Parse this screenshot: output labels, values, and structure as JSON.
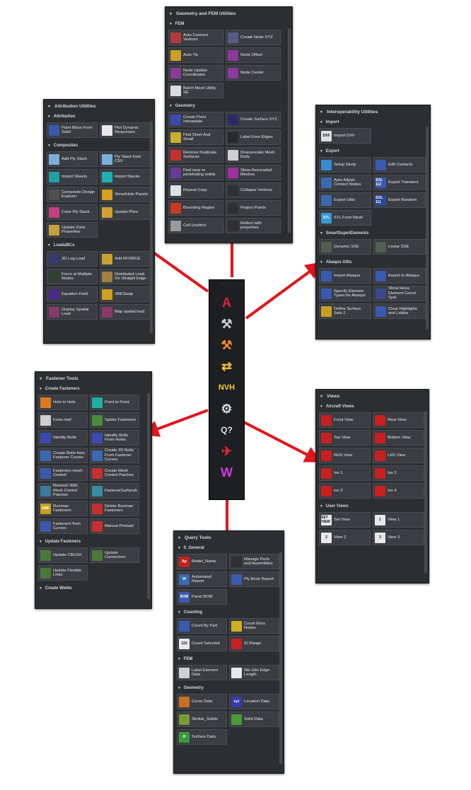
{
  "colors": {
    "arrow": "#e3141b",
    "panel_bg": "#2c2e31",
    "button_bg": "#3a3d42",
    "text": "#e8e8e8"
  },
  "toolbar": {
    "grip": "::::::::",
    "items": [
      {
        "icon": "attribution-icon",
        "glyph": "A",
        "color": "#e52233"
      },
      {
        "icon": "geometry-tools-icon",
        "glyph": "⚒",
        "color": "#cfcfcf"
      },
      {
        "icon": "fastener-tools-icon",
        "glyph": "⚒",
        "color": "#f08a24"
      },
      {
        "icon": "interoperability-icon",
        "glyph": "⇄",
        "color": "#f2c230"
      },
      {
        "icon": "nvh-icon",
        "glyph": "NVH",
        "color": "#f2d130"
      },
      {
        "icon": "query-tools-icon",
        "glyph": "⚙",
        "color": "#d8d8d8"
      },
      {
        "icon": "query-icon",
        "glyph": "Q?",
        "color": "#e0e0e0"
      },
      {
        "icon": "aircraft-views-icon",
        "glyph": "✈",
        "color": "#e8262b"
      },
      {
        "icon": "user-views-icon",
        "glyph": "W",
        "color": "#d13bd8"
      }
    ]
  },
  "geometry_panel": {
    "title": "Geometry and FEM Utilities",
    "sections": [
      {
        "label": "FEM",
        "buttons": [
          {
            "label": "Auto Connect Vertices",
            "icon": "auto-connect-icon",
            "color": "#b33a3a"
          },
          {
            "label": "Create Node XYZ",
            "icon": "create-node-icon",
            "color": "#5a5a8a"
          },
          {
            "label": "Auto Tie",
            "icon": "auto-tie-icon",
            "color": "#c8a028"
          },
          {
            "label": "Node Offset",
            "icon": "node-offset-icon",
            "color": "#8a3a9a"
          },
          {
            "label": "Node Update Coordinates",
            "icon": "node-update-icon",
            "color": "#8a3a9a"
          },
          {
            "label": "Node Center",
            "icon": "node-center-icon",
            "color": "#8a3a9a"
          },
          {
            "label": "Batch Mesh Utility SE",
            "icon": "batch-mesh-icon",
            "color": "#dcdcdc"
          }
        ]
      },
      {
        "label": "Geometry",
        "buttons": [
          {
            "label": "Create Point Interpolate",
            "icon": "create-point-icon",
            "color": "#3a4ab0"
          },
          {
            "label": "Create Surface XYZ",
            "icon": "create-surface-icon",
            "color": "#2a2a6a"
          },
          {
            "label": "Find Short And Small",
            "icon": "find-short-icon",
            "color": "#c8b030"
          },
          {
            "label": "Label Free Edges",
            "icon": "label-free-edges-icon",
            "color": "#2a2a2a"
          },
          {
            "label": "Remove Duplicate Surfaces",
            "icon": "remove-duplicate-icon",
            "color": "#c83030"
          },
          {
            "label": "Disassociate Mesh Body",
            "icon": "disassociate-icon",
            "color": "#d0d0d0"
          },
          {
            "label": "Find near or penetrating solids",
            "icon": "find-near-icon",
            "color": "#6a3a9a"
          },
          {
            "label": "Show Associated Meshes",
            "icon": "show-associated-icon",
            "color": "#a030a0"
          },
          {
            "label": "Repeat Copy",
            "icon": "repeat-copy-icon",
            "color": "#e0e0e0"
          },
          {
            "label": "Collapse Vertices",
            "icon": "collapse-vertices-icon",
            "color": "#303030"
          },
          {
            "label": "Bounding Region",
            "icon": "bounding-region-icon",
            "color": "#c83a20"
          },
          {
            "label": "Project Points",
            "icon": "project-points-icon",
            "color": "#303030"
          },
          {
            "label": "Cell Unstitch",
            "icon": "cell-unstitch-icon",
            "color": "#9a9a9a"
          },
          {
            "label": "Reflect with properties",
            "icon": "reflect-icon",
            "color": "#303030"
          }
        ]
      }
    ]
  },
  "attribution_panel": {
    "title": "Attribution Utilities",
    "sections": [
      {
        "label": "Attribution",
        "buttons": [
          {
            "label": "Point Mass From Solid",
            "icon": "point-mass-icon",
            "color": "#3a5ab0"
          },
          {
            "label": "Plot Dynamic Responses",
            "icon": "plot-dynamic-icon",
            "color": "#e8e8e8"
          }
        ]
      },
      {
        "label": "Composites",
        "buttons": [
          {
            "label": "Add Ply Stack",
            "icon": "add-ply-stack-icon",
            "color": "#7ab0d8"
          },
          {
            "label": "Ply Stack from CSV",
            "icon": "ply-stack-csv-icon",
            "color": "#7ab0d8"
          },
          {
            "label": "Import Sheets",
            "icon": "import-sheets-icon",
            "color": "#20a0a0"
          },
          {
            "label": "Import Stacks",
            "icon": "import-stacks-icon",
            "color": "#20b0b0"
          },
          {
            "label": "Composite Design Explorer",
            "icon": "composite-explorer-icon",
            "color": "#505050"
          },
          {
            "label": "Show/Hide Panels",
            "icon": "show-hide-panels-icon",
            "color": "#d8a020"
          },
          {
            "label": "Color Ply Stack",
            "icon": "color-ply-icon",
            "color": "#c04080"
          },
          {
            "label": "Update Plies",
            "icon": "update-plies-icon",
            "color": "#d0a030"
          },
          {
            "label": "Update Zone Properties",
            "icon": "update-zone-icon",
            "color": "#c8a040"
          }
        ]
      },
      {
        "label": "LoadsBCs",
        "buttons": [
          {
            "label": "3D Lug Load",
            "icon": "lug-load-icon",
            "color": "#3a3a6a"
          },
          {
            "label": "Add RFORCE",
            "icon": "add-rforce-icon",
            "color": "#c8a030"
          },
          {
            "label": "Force at Multiple Nodes",
            "icon": "force-nodes-icon",
            "color": "#304030"
          },
          {
            "label": "Distributed Load On Straight Edge",
            "icon": "distributed-load-icon",
            "color": "#a08040"
          },
          {
            "label": "Equation Field",
            "icon": "equation-field-icon",
            "color": "#4a2a8a"
          },
          {
            "label": "XBESwap",
            "icon": "xbeswap-icon",
            "color": "#d0a020"
          },
          {
            "label": "Display Spatial Load",
            "icon": "display-spatial-icon",
            "color": "#8a3a6a"
          },
          {
            "label": "Map spatial load",
            "icon": "map-spatial-icon",
            "color": "#8a3a6a"
          }
        ]
      }
    ]
  },
  "interop_panel": {
    "title": "Interoperability Utilities",
    "sections": [
      {
        "label": "Import",
        "buttons": [
          {
            "label": "Import DXF",
            "icon": "dxf-icon",
            "color": "#e0e0e0",
            "text": "DXF"
          }
        ]
      },
      {
        "label": "Export",
        "buttons": [
          {
            "label": "Setup Study",
            "icon": "setup-study-icon",
            "color": "#3a8ad0"
          },
          {
            "label": "Edit Contacts",
            "icon": "edit-contacts-icon",
            "color": "#3a5ab0"
          },
          {
            "label": "Auto Adjust Contact Nodes",
            "icon": "auto-adjust-icon",
            "color": "#3a6ab0"
          },
          {
            "label": "Export Transient",
            "icon": "export-transient-icon",
            "color": "#3a5ab0",
            "text": "SOL 112"
          },
          {
            "label": "Export Utils",
            "icon": "export-utils-icon",
            "color": "#3a6ab0"
          },
          {
            "label": "Export Random",
            "icon": "export-random-icon",
            "color": "#2a4a9a",
            "text": "SOL 111"
          },
          {
            "label": "STL From Mesh",
            "icon": "stl-icon",
            "color": "#3a9ad0",
            "text": "STL"
          }
        ]
      },
      {
        "label": "SmartSuperElements",
        "buttons": [
          {
            "label": "Dynamic SSE",
            "icon": "dynamic-sse-icon",
            "color": "#506050"
          },
          {
            "label": "Linear SSE",
            "icon": "linear-sse-icon",
            "color": "#506050"
          }
        ]
      },
      {
        "label": "Abaqus Utils",
        "buttons": [
          {
            "label": "Import Abaqus",
            "icon": "import-abaqus-icon",
            "color": "#3a5ab0"
          },
          {
            "label": "Export to Abaqus",
            "icon": "export-abaqus-icon",
            "color": "#3a5ab0"
          },
          {
            "label": "Specify Element Types for Abaqus",
            "icon": "specify-element-icon",
            "color": "#3a5ab0"
          },
          {
            "label": "Show Hexa Element Coord Syst",
            "icon": "show-hexa-icon",
            "color": "#3a4a8a"
          },
          {
            "label": "Define Surface Sets 2",
            "icon": "define-surface-icon",
            "color": "#c8a020"
          },
          {
            "label": "Clear Highlights and Lables",
            "icon": "clear-highlights-icon",
            "color": "#3a5ab0"
          }
        ]
      }
    ]
  },
  "fastener_panel": {
    "title": "Fastener Tools",
    "sections": [
      {
        "label": "Create Fasteners",
        "buttons": [
          {
            "label": "Hole to Hole",
            "icon": "hole-to-hole-icon",
            "color": "#e07a20"
          },
          {
            "label": "Point to Point",
            "icon": "point-to-point-icon",
            "color": "#20b0a0"
          },
          {
            "label": "From mwf",
            "icon": "from-mwf-icon",
            "color": "#d0d0d0"
          },
          {
            "label": "Spider Fasteners",
            "icon": "spider-fasteners-icon",
            "color": "#4a8a3a"
          },
          {
            "label": "Identify Bolts",
            "icon": "identify-bolts-icon",
            "color": "#3a4ab0"
          },
          {
            "label": "Identify Bolts From Holes",
            "icon": "identify-holes-icon",
            "color": "#3a4ab0"
          },
          {
            "label": "Create Bolts from Fastener Curves",
            "icon": "create-bolts-icon",
            "color": "#3a6ab0"
          },
          {
            "label": "Create 2D Bolts From Fastener Curves",
            "icon": "create-2d-bolts-icon",
            "color": "#3a6ab0"
          },
          {
            "label": "Fasteners mesh Control",
            "icon": "mesh-control-icon",
            "color": "#3a5ab0"
          },
          {
            "label": "Create Mesh Control Patches",
            "icon": "mesh-patches-icon",
            "color": "#c83030"
          },
          {
            "label": "Remesh With Mesh Control Patches",
            "icon": "remesh-icon",
            "color": "#3a7a9a"
          },
          {
            "label": "FastenerSurfaceMesh",
            "icon": "fastener-surface-icon",
            "color": "#3a8aa0"
          },
          {
            "label": "Runman Fasteners",
            "icon": "runman-icon",
            "color": "#c8a020",
            "text": "RMF"
          },
          {
            "label": "Delete Runman Fasteners",
            "icon": "delete-runman-icon",
            "color": "#c83030"
          },
          {
            "label": "Fasteners from Curves",
            "icon": "fasteners-curves-icon",
            "color": "#3a5ab0"
          },
          {
            "label": "Manual Preload",
            "icon": "manual-preload-icon",
            "color": "#c83030"
          }
        ]
      },
      {
        "label": "Update Fasteners",
        "buttons": [
          {
            "label": "Update CBUSH",
            "icon": "update-cbush-icon",
            "color": "#4a7a3a"
          },
          {
            "label": "Update Connectors",
            "icon": "update-connectors-icon",
            "color": "#4a7a3a"
          },
          {
            "label": "Update Flexible Links",
            "icon": "update-flexible-icon",
            "color": "#4a7a3a"
          }
        ]
      },
      {
        "label": "Create Welds",
        "buttons": []
      }
    ]
  },
  "views_panel": {
    "title": "Views",
    "sections": [
      {
        "label": "Aircraft Views",
        "buttons": [
          {
            "label": "Front View",
            "icon": "front-view-icon",
            "color": "#c82020"
          },
          {
            "label": "Rear View",
            "icon": "rear-view-icon",
            "color": "#c82020"
          },
          {
            "label": "Top View",
            "icon": "top-view-icon",
            "color": "#c82020"
          },
          {
            "label": "Bottom View",
            "icon": "bottom-view-icon",
            "color": "#c82020"
          },
          {
            "label": "RHS View",
            "icon": "rhs-view-icon",
            "color": "#c82020"
          },
          {
            "label": "LHS View",
            "icon": "lhs-view-icon",
            "color": "#c82020"
          },
          {
            "label": "Iso 1",
            "icon": "iso1-icon",
            "color": "#c82020"
          },
          {
            "label": "Iso 2",
            "icon": "iso2-icon",
            "color": "#c82020"
          },
          {
            "label": "Iso 3",
            "icon": "iso3-icon",
            "color": "#c82020"
          },
          {
            "label": "Iso 4",
            "icon": "iso4-icon",
            "color": "#c82020"
          }
        ]
      },
      {
        "label": "User Views",
        "buttons": [
          {
            "label": "Set View",
            "icon": "set-view-icon",
            "color": "#e8e8e8",
            "text": "SET VIEW"
          },
          {
            "label": "View 1",
            "icon": "view1-icon",
            "color": "#e8e8e8",
            "text": "1"
          },
          {
            "label": "View 2",
            "icon": "view2-icon",
            "color": "#e8e8e8",
            "text": "2"
          },
          {
            "label": "View 3",
            "icon": "view3-icon",
            "color": "#e8e8e8",
            "text": "3"
          }
        ]
      }
    ]
  },
  "query_panel": {
    "title": "Query Tools",
    "sections": [
      {
        "label": "0_General",
        "buttons": [
          {
            "label": "Model_Name",
            "icon": "model-name-icon",
            "color": "#c82020",
            "text": "Ap"
          },
          {
            "label": "Manage Parts and Assemblies",
            "icon": "manage-parts-icon",
            "color": "#303030"
          },
          {
            "label": "Automated Report",
            "icon": "automated-report-icon",
            "color": "#3a6ab0",
            "text": "W"
          },
          {
            "label": "Ply Book Report",
            "icon": "ply-book-icon",
            "color": "#3a5ab0"
          },
          {
            "label": "Panel BOM",
            "icon": "panel-bom-icon",
            "color": "#3a5ab0",
            "text": "BOM"
          }
        ]
      },
      {
        "label": "Counting",
        "buttons": [
          {
            "label": "Count By Part",
            "icon": "count-part-icon",
            "color": "#3a5ab0"
          },
          {
            "label": "Count Elms Nodes",
            "icon": "count-elms-icon",
            "color": "#d0b020"
          },
          {
            "label": "Count Selected",
            "icon": "count-selected-icon",
            "color": "#e8e8e8",
            "text": "123"
          },
          {
            "label": "ID Range",
            "icon": "id-range-icon",
            "color": "#c82020"
          }
        ]
      },
      {
        "label": "FEM",
        "buttons": [
          {
            "label": "Label Element Data",
            "icon": "label-element-icon",
            "color": "#d0d0d0"
          },
          {
            "label": "Min Elm Edge Length",
            "icon": "min-elm-icon",
            "color": "#e8e8e8"
          }
        ]
      },
      {
        "label": "Geometry",
        "buttons": [
          {
            "label": "Curve Data",
            "icon": "curve-data-icon",
            "color": "#c87020"
          },
          {
            "label": "Location Data",
            "icon": "location-data-icon",
            "color": "#3a3ab0",
            "text": "xyz"
          },
          {
            "label": "Similar_Solids",
            "icon": "similar-solids-icon",
            "color": "#7a9a3a"
          },
          {
            "label": "Solid Data",
            "icon": "solid-data-icon",
            "color": "#4a9a3a"
          },
          {
            "label": "Surface Data",
            "icon": "surface-data-icon",
            "color": "#3a9a3a",
            "text": "R"
          }
        ]
      }
    ]
  }
}
